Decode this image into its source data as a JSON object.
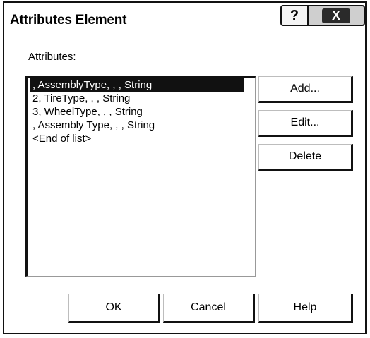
{
  "window": {
    "title": "Attributes Element",
    "help_button": "?",
    "close_button": "X"
  },
  "attributes": {
    "label": "Attributes:",
    "items": [
      ", AssemblyType, , , String",
      "2, TireType, , , String",
      "3, WheelType, , , String",
      ", Assembly Type, , , String",
      "<End of list>"
    ],
    "selected_index": 0
  },
  "side_buttons": {
    "add": "Add...",
    "edit": "Edit...",
    "delete": "Delete"
  },
  "bottom_buttons": {
    "ok": "OK",
    "cancel": "Cancel",
    "help": "Help"
  }
}
